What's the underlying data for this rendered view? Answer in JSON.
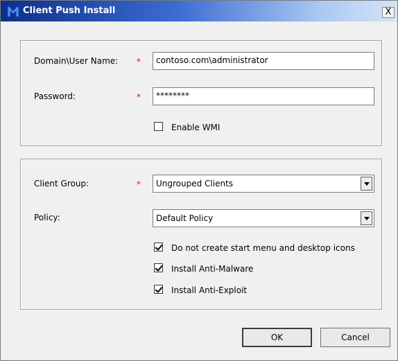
{
  "window": {
    "title": "Client Push Install",
    "close_glyph": "X",
    "title_icon": "malwarebytes-logo-icon",
    "title_icon_color": "#4f8ef7"
  },
  "credentials": {
    "username_label": "Domain\\User Name:",
    "username_value": "contoso.com\\administrator",
    "password_label": "Password:",
    "password_value": "********",
    "required_marker": "*",
    "enable_wmi": {
      "label": "Enable WMI",
      "checked": false
    }
  },
  "settings": {
    "client_group_label": "Client Group:",
    "client_group_value": "Ungrouped Clients",
    "policy_label": "Policy:",
    "policy_value": "Default Policy",
    "required_marker": "*",
    "options": [
      {
        "label": "Do not create start menu and desktop icons",
        "checked": true
      },
      {
        "label": "Install Anti-Malware",
        "checked": true
      },
      {
        "label": "Install Anti-Exploit",
        "checked": true
      }
    ]
  },
  "buttons": {
    "ok_label": "OK",
    "cancel_label": "Cancel"
  },
  "colors": {
    "required": "#e01515",
    "title_text": "#ffffff"
  }
}
